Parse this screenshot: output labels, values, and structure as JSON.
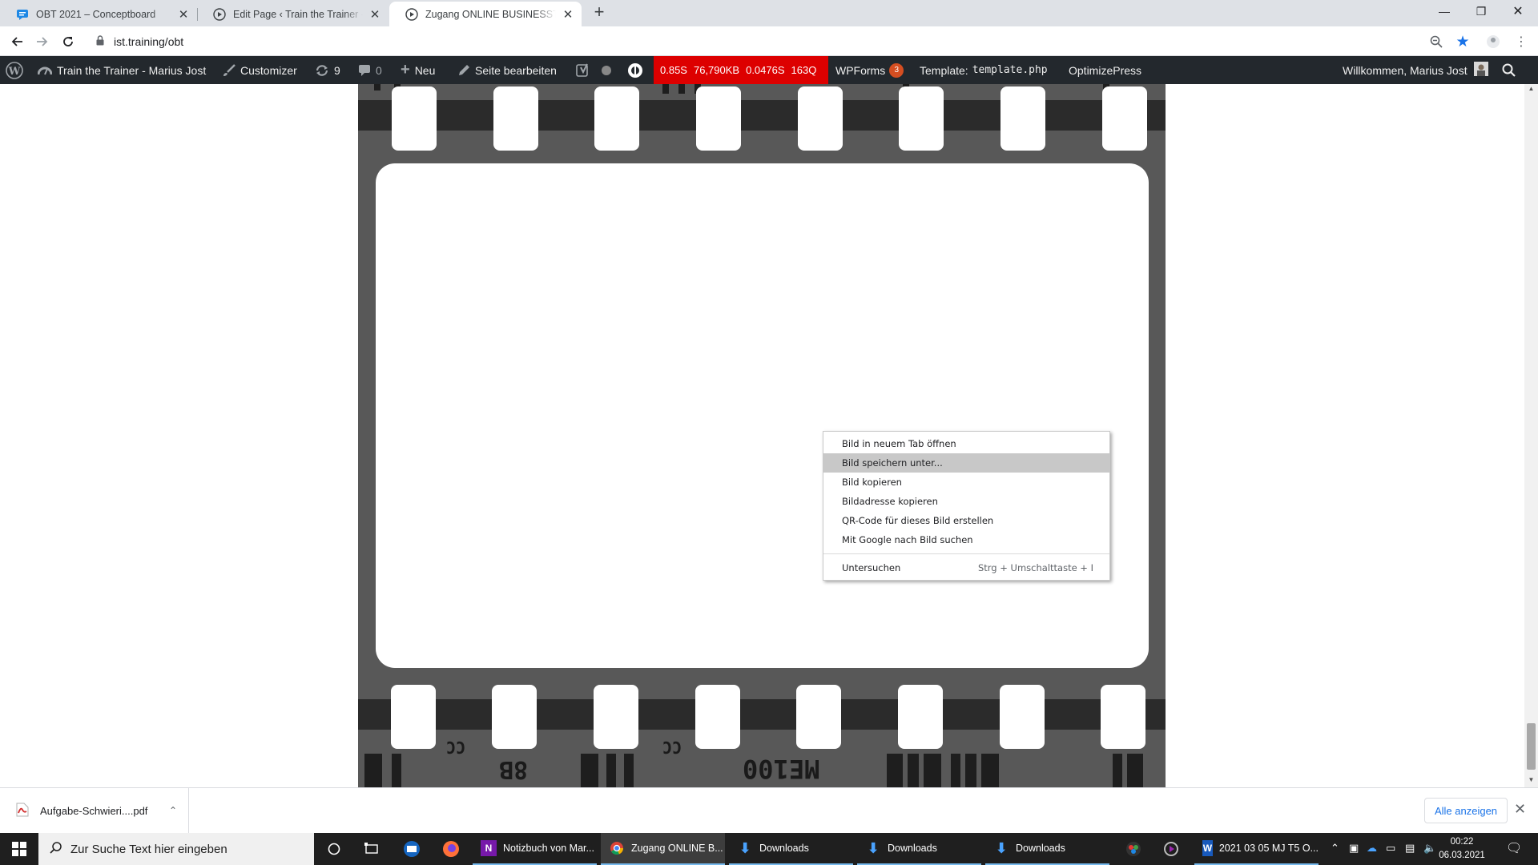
{
  "tabs": [
    {
      "title": "OBT 2021 – Conceptboard",
      "icon": "conceptboard-icon",
      "active": false
    },
    {
      "title": "Edit Page ‹ Train the Trainer - Marius Jost",
      "icon": "wordpress-icon",
      "active": false
    },
    {
      "title": "Zugang ONLINE BUSINESSTRAINER",
      "icon": "wordpress-icon",
      "active": true
    }
  ],
  "address": {
    "url": "ist.training/obt"
  },
  "adminbar": {
    "site": "Train the Trainer - Marius Jost",
    "customizer": "Customizer",
    "updates": "9",
    "comments": "0",
    "new": "Neu",
    "edit": "Seite bearbeiten",
    "qm": {
      "time": "0.85S",
      "memory": "76,790KB",
      "db_time": "0.0476S",
      "queries": "163Q",
      "color": "#dd0000"
    },
    "wpforms": "WPForms",
    "wpforms_count": "3",
    "template_label": "Template:",
    "template_file": "template.php",
    "optimizepress": "OptimizePress",
    "welcome": "Willkommen, Marius Jost"
  },
  "film": {
    "marks": [
      "CC",
      "8B",
      "CC",
      "ME100"
    ]
  },
  "context_menu": {
    "items": [
      {
        "label": "Bild in neuem Tab öffnen",
        "shortcut": "",
        "highlighted": false
      },
      {
        "label": "Bild speichern unter...",
        "shortcut": "",
        "highlighted": true
      },
      {
        "label": "Bild kopieren",
        "shortcut": "",
        "highlighted": false
      },
      {
        "label": "Bildadresse kopieren",
        "shortcut": "",
        "highlighted": false
      },
      {
        "label": "QR-Code für dieses Bild erstellen",
        "shortcut": "",
        "highlighted": false
      },
      {
        "label": "Mit Google nach Bild suchen",
        "shortcut": "",
        "highlighted": false
      }
    ],
    "inspect": {
      "label": "Untersuchen",
      "shortcut": "Strg + Umschalttaste + I"
    }
  },
  "download_shelf": {
    "file": "Aufgabe-Schwieri....pdf",
    "show_all": "Alle anzeigen"
  },
  "taskbar": {
    "search_placeholder": "Zur Suche Text hier eingeben",
    "apps": [
      {
        "label": "Notizbuch von Mar...",
        "icon": "onenote-icon"
      },
      {
        "label": "Zugang ONLINE B...",
        "icon": "chrome-icon"
      },
      {
        "label": "Downloads",
        "icon": "download-folder-icon"
      },
      {
        "label": "Downloads",
        "icon": "download-folder-icon"
      },
      {
        "label": "Downloads",
        "icon": "download-folder-icon"
      },
      {
        "label": "2021 03 05 MJ T5 O...",
        "icon": "word-icon"
      }
    ],
    "time": "00:22",
    "date": "06.03.2021"
  },
  "colors": {
    "adminbar": "#23282d",
    "tabstrip": "#dee1e6",
    "film": "#585858",
    "taskbar": "#1f1f1f",
    "link": "#1a73e8"
  }
}
